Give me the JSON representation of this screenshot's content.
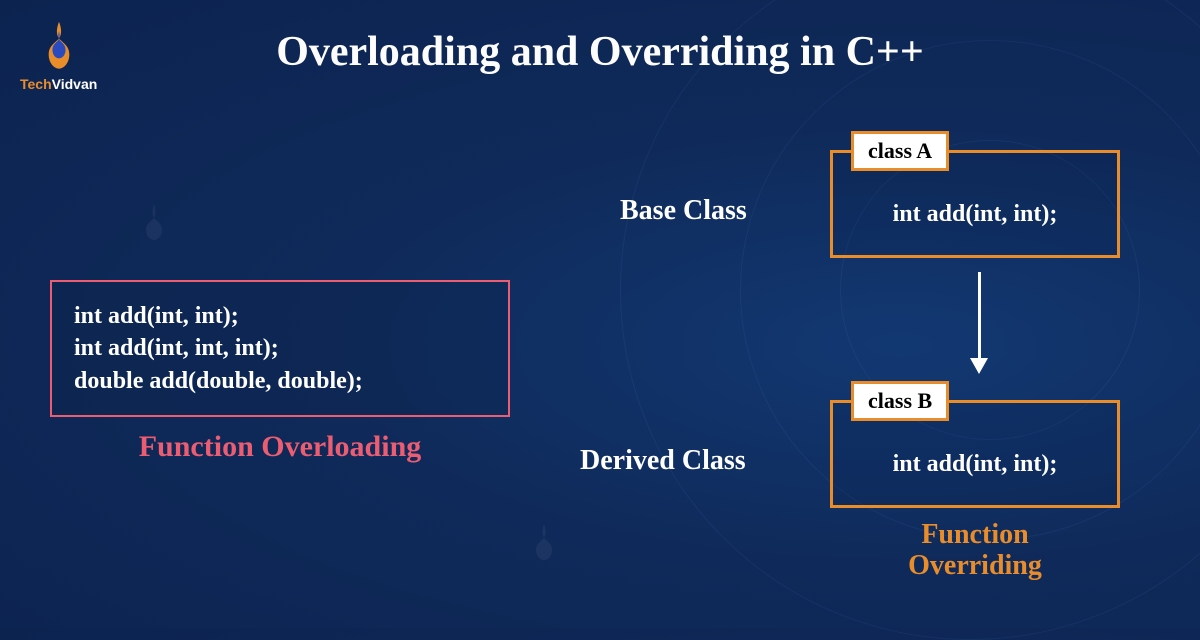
{
  "logo": {
    "name_part1": "Tech",
    "name_part2": "Vidvan"
  },
  "title": "Overloading and Overriding in C++",
  "overloading": {
    "lines": [
      "int add(int, int);",
      "int add(int, int, int);",
      "double add(double, double);"
    ],
    "caption": "Function Overloading"
  },
  "overriding": {
    "base_label": "Base Class",
    "derived_label": "Derived Class",
    "class_a": {
      "tab": "class A",
      "body": "int add(int, int);"
    },
    "class_b": {
      "tab": "class B",
      "body": "int add(int, int);"
    },
    "caption_line1": "Function",
    "caption_line2": "Overriding"
  },
  "colors": {
    "accent_pink": "#ec5d72",
    "accent_orange": "#e98c2a",
    "bg_primary": "#0f2a5a"
  }
}
